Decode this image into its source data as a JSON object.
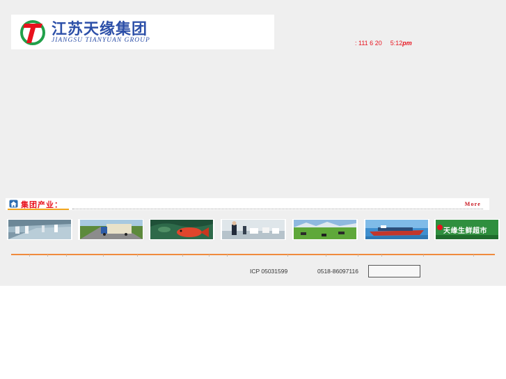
{
  "header": {
    "logo_cn": "江苏天缘集团",
    "logo_en": "JIANGSU TIANYUAN GROUP",
    "logo_letter": "T"
  },
  "clock": {
    "date": ": 111 6 20",
    "time": "5:12",
    "ampm": "pm"
  },
  "industry": {
    "title": "集团产业：",
    "more": "More",
    "thumbnails": [
      {
        "name": "factory-floor-photo"
      },
      {
        "name": "truck-highway-photo"
      },
      {
        "name": "red-fish-photo"
      },
      {
        "name": "office-staff-photo"
      },
      {
        "name": "grassland-cattle-photo"
      },
      {
        "name": "cargo-ship-photo"
      },
      {
        "name": "supermarket-sign-photo",
        "caption": "天缘生鲜超市"
      }
    ]
  },
  "footer": {
    "icp": "ICP 05031599",
    "phone": "0518-86097116"
  },
  "colors": {
    "brand_blue": "#2c4fa8",
    "accent_red": "#e8121d",
    "accent_orange": "#f08a3c",
    "logo_green": "#21a04a"
  }
}
